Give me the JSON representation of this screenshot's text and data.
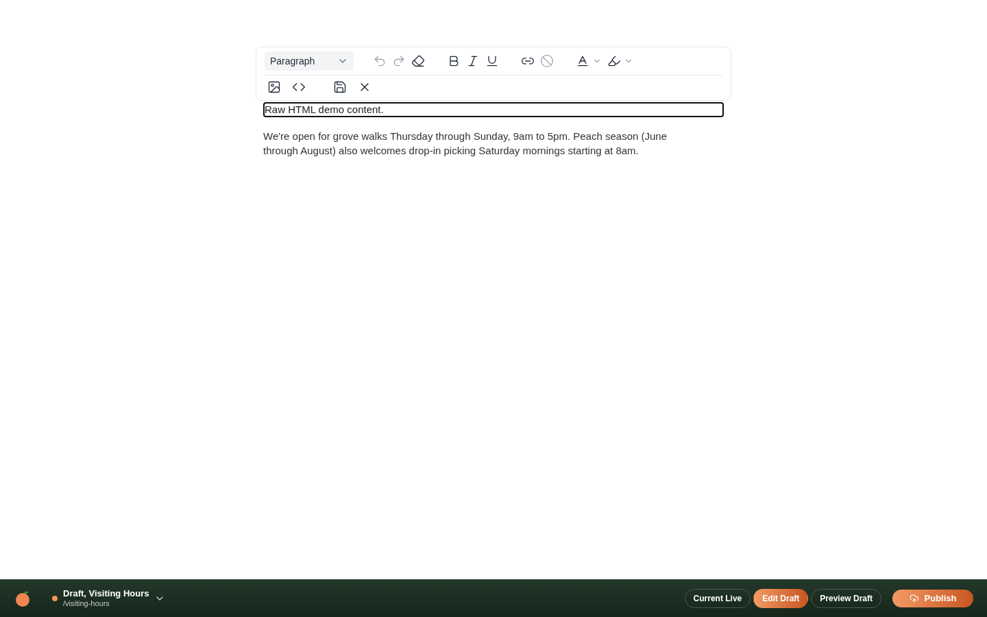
{
  "toolbar": {
    "block_type": "Paragraph",
    "buttons": [
      {
        "kind": "undo",
        "disabled": true
      },
      {
        "kind": "redo",
        "disabled": true
      },
      {
        "kind": "eraser",
        "disabled": false
      },
      {
        "kind": "bold",
        "disabled": false
      },
      {
        "kind": "italic",
        "disabled": false
      },
      {
        "kind": "underline",
        "disabled": false
      },
      {
        "kind": "link",
        "disabled": false
      },
      {
        "kind": "unlink",
        "disabled": true
      },
      {
        "kind": "text-color",
        "disabled": false
      },
      {
        "kind": "highlight",
        "disabled": false
      }
    ],
    "row2": [
      {
        "kind": "image"
      },
      {
        "kind": "code"
      },
      {
        "kind": "save"
      },
      {
        "kind": "close"
      }
    ]
  },
  "raw_html": "Raw HTML demo content.",
  "paragraph": "We're open for grove walks Thursday through Sunday, 9am to 5pm. Peach season (June through August) also welcomes drop-in picking Saturday mornings starting at 8am.",
  "bottom_bar": {
    "title": "Draft, Visiting Hours",
    "path": "/visiting-hours",
    "tabs": [
      {
        "label": "Current Live",
        "selected": false
      },
      {
        "label": "Edit Draft",
        "selected": true
      },
      {
        "label": "Preview Draft",
        "selected": false
      }
    ],
    "publish": "Publish"
  }
}
